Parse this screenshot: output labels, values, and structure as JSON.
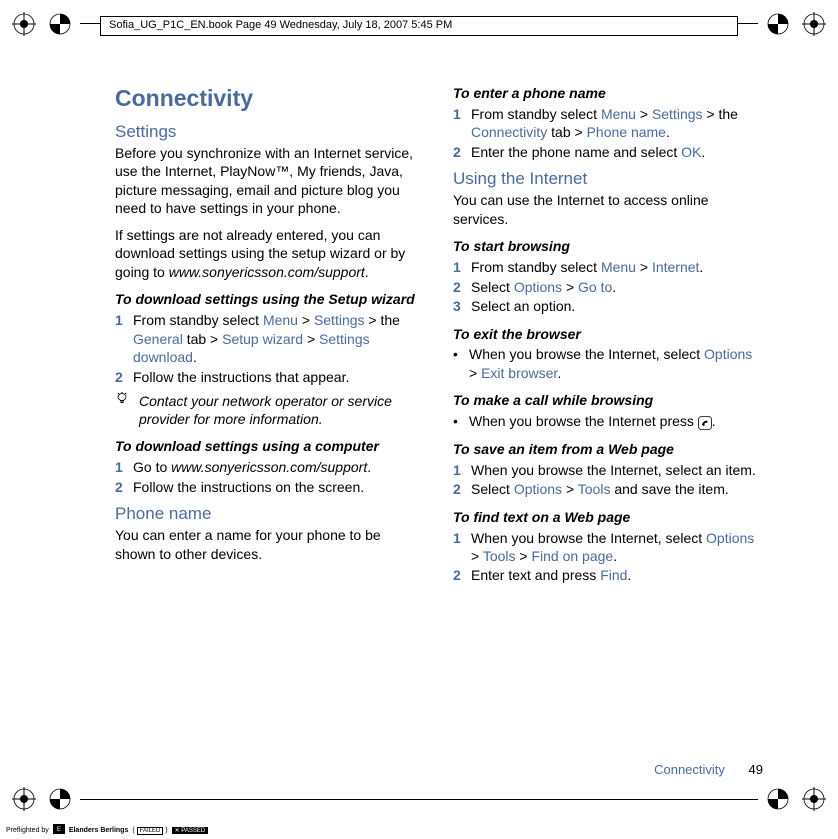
{
  "header": {
    "text": "Sofia_UG_P1C_EN.book  Page 49  Wednesday, July 18, 2007  5:45 PM"
  },
  "col1": {
    "h1": "Connectivity",
    "settings_h2": "Settings",
    "settings_p1": "Before you synchronize with an Internet service, use the Internet, PlayNow™, My friends, Java, picture messaging, email and picture blog you need to have settings in your phone.",
    "settings_p2a": "If settings are not already entered, you can download settings using the setup wizard or by going to ",
    "settings_p2_url": "www.sonyericsson.com/support",
    "settings_p2b": ".",
    "dl_wizard_sub": "To download settings using the Setup wizard",
    "step1_num": "1",
    "step1_a": "From standby select ",
    "step1_menu": "Menu",
    "step1_gt1": " > ",
    "step1_settings": "Settings",
    "step1_gt2": " > the ",
    "step1_general": "General",
    "step1_tab": " tab > ",
    "step1_setup": "Setup wizard",
    "step1_gt3": " > ",
    "step1_sd": "Settings download",
    "step1_dot": ".",
    "step2_num": "2",
    "step2": "Follow the instructions that appear.",
    "tip": "Contact your network operator or service provider for more information.",
    "dl_comp_sub": "To download settings using a computer",
    "comp1_num": "1",
    "comp1_a": "Go to ",
    "comp1_url": "www.sonyericsson.com/support",
    "comp1_b": ".",
    "comp2_num": "2",
    "comp2": "Follow the instructions on the screen.",
    "phone_h2": "Phone name",
    "phone_p": "You can enter a name for your phone to be shown to other devices."
  },
  "col2": {
    "enter_sub": "To enter a phone name",
    "e1_num": "1",
    "e1_a": "From standby select ",
    "e1_menu": "Menu",
    "e1_gt1": " > ",
    "e1_settings": "Settings",
    "e1_gt2": " > the ",
    "e1_conn": "Connectivity",
    "e1_tab": " tab > ",
    "e1_pn": "Phone name",
    "e1_dot": ".",
    "e2_num": "2",
    "e2_a": "Enter the phone name and select ",
    "e2_ok": "OK",
    "e2_dot": ".",
    "internet_h2": "Using the Internet",
    "internet_p": "You can use the Internet to access online services.",
    "start_sub": "To start browsing",
    "s1_num": "1",
    "s1_a": "From standby select ",
    "s1_menu": "Menu",
    "s1_gt1": " > ",
    "s1_internet": "Internet",
    "s1_dot": ".",
    "s2_num": "2",
    "s2_a": "Select ",
    "s2_options": "Options",
    "s2_gt1": " > ",
    "s2_goto": "Go to",
    "s2_dot": ".",
    "s3_num": "3",
    "s3": "Select an option.",
    "exit_sub": "To exit the browser",
    "exit_a": "When you browse the Internet, select ",
    "exit_options": "Options",
    "exit_gt": " > ",
    "exit_eb": "Exit browser",
    "exit_dot": ".",
    "call_sub": "To make a call while browsing",
    "call_a": "When you browse the Internet press ",
    "call_dot": ".",
    "save_sub": "To save an item from a Web page",
    "sv1_num": "1",
    "sv1": "When you browse the Internet, select an item.",
    "sv2_num": "2",
    "sv2_a": "Select ",
    "sv2_options": "Options",
    "sv2_gt": " > ",
    "sv2_tools": "Tools",
    "sv2_b": " and save the item.",
    "find_sub": "To find text on a Web page",
    "f1_num": "1",
    "f1_a": "When you browse the Internet, select ",
    "f1_options": "Options",
    "f1_gt1": " > ",
    "f1_tools": "Tools",
    "f1_gt2": " > ",
    "f1_fop": "Find on page",
    "f1_dot": ".",
    "f2_num": "2",
    "f2_a": "Enter text and press ",
    "f2_find": "Find",
    "f2_dot": "."
  },
  "footer": {
    "section": "Connectivity",
    "page": "49"
  },
  "preflight": {
    "label": "Preflighted by",
    "brand": "Elanders Berlings",
    "failed": "FAILED",
    "passed": "PASSED"
  }
}
